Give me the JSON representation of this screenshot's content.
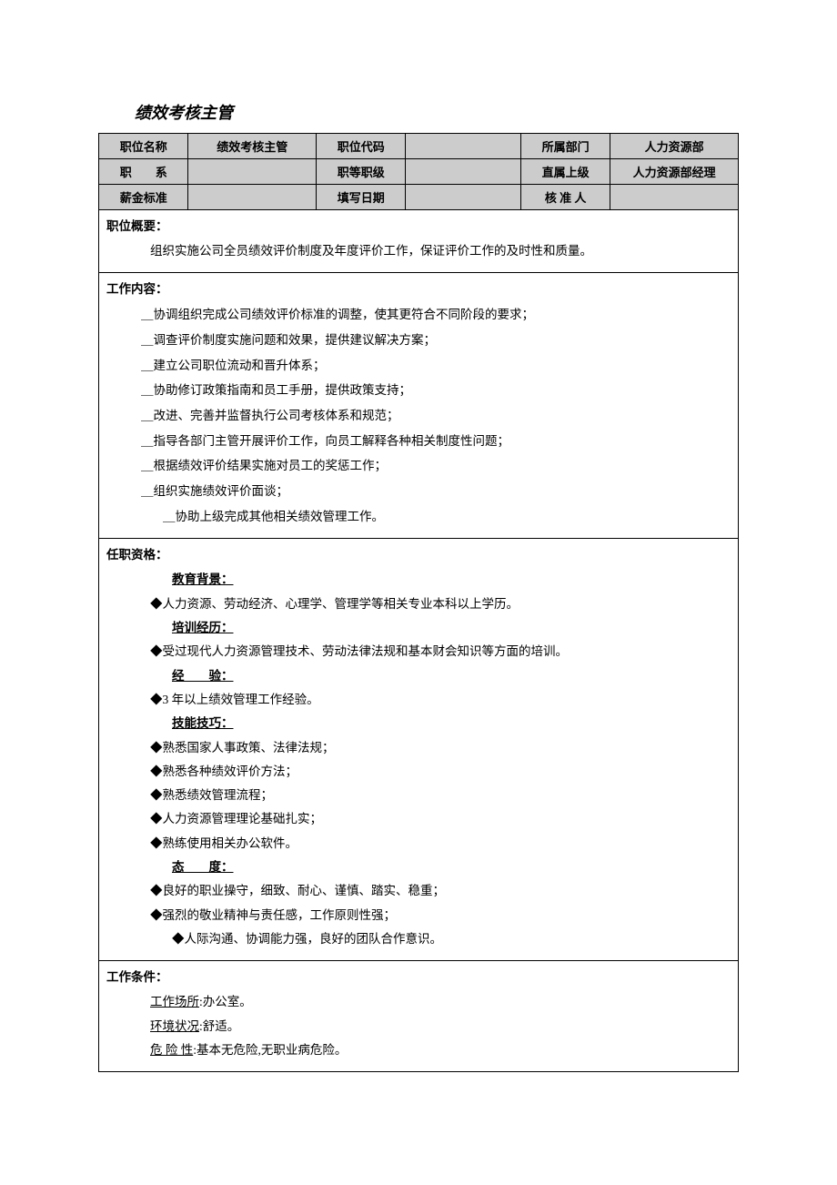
{
  "title": "绩效考核主管",
  "header": {
    "r1": {
      "c1": "职位名称",
      "c2": "绩效考核主管",
      "c3": "职位代码",
      "c4": "",
      "c5": "所属部门",
      "c6": "人力资源部"
    },
    "r2": {
      "c1": "职　　系",
      "c2": "",
      "c3": "职等职级",
      "c4": "",
      "c5": "直属上级",
      "c6": "人力资源部经理"
    },
    "r3": {
      "c1": "薪金标准",
      "c2": "",
      "c3": "填写日期",
      "c4": "",
      "c5": "核 准 人",
      "c6": ""
    }
  },
  "summary": {
    "label": "职位概要：",
    "text": "组织实施公司全员绩效评价制度及年度评价工作，保证评价工作的及时性和质量。"
  },
  "duties": {
    "label": "工作内容：",
    "items": [
      "＿协调组织完成公司绩效评价标准的调整，使其更符合不同阶段的要求；",
      "＿调查评价制度实施问题和效果，提供建议解决方案；",
      "＿建立公司职位流动和晋升体系；",
      "＿协助修订政策指南和员工手册，提供政策支持；",
      "＿改进、完善并监督执行公司考核体系和规范；",
      "＿指导各部门主管开展评价工作，向员工解释各种相关制度性问题；",
      "＿根据绩效评价结果实施对员工的奖惩工作；",
      "＿组织实施绩效评价面谈；"
    ],
    "last": "＿协助上级完成其他相关绩效管理工作。"
  },
  "qual": {
    "label": "任职资格：",
    "edu_h": "教育背景：",
    "edu": "◆人力资源、劳动经济、心理学、管理学等相关专业本科以上学历。",
    "train_h": "培训经历：",
    "train": "◆受过现代人力资源管理技术、劳动法律法规和基本财会知识等方面的培训。",
    "exp_h": "经　　验：",
    "exp": "◆3 年以上绩效管理工作经验。",
    "skill_h": "技能技巧：",
    "skills": [
      "◆熟悉国家人事政策、法律法规；",
      "◆熟悉各种绩效评价方法；",
      "◆熟悉绩效管理流程；",
      "◆人力资源管理理论基础扎实；",
      "◆熟练使用相关办公软件。"
    ],
    "att_h": "态　　度：",
    "atts": [
      "◆良好的职业操守，细致、耐心、谨慎、踏实、稳重；",
      "◆强烈的敬业精神与责任感，工作原则性强；"
    ],
    "att_last": "◆人际沟通、协调能力强，良好的团队合作意识。"
  },
  "cond": {
    "label": "工作条件：",
    "place_h": "工作场所",
    "place": ":办公室。",
    "env_h": "环境状况",
    "env": ":舒适。",
    "risk_h": "危 险 性",
    "risk": ":基本无危险,无职业病危险。"
  }
}
